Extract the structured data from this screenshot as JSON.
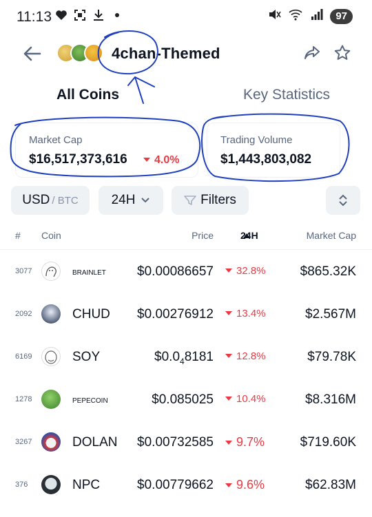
{
  "status_bar": {
    "time": "11:13",
    "battery": "97"
  },
  "header": {
    "title": "4chan-Themed"
  },
  "tabs": [
    {
      "label": "All Coins"
    },
    {
      "label": "Key Statistics"
    }
  ],
  "stats": {
    "market_cap_label": "Market Cap",
    "market_cap_value": "$16,517,373,616",
    "market_cap_change": "4.0%",
    "trading_volume_label": "Trading Volume",
    "trading_volume_value": "$1,443,803,082"
  },
  "controls": {
    "currency": "USD",
    "currency_alt": "/ BTC",
    "period": "24H",
    "filters": "Filters"
  },
  "table": {
    "headers": {
      "rank": "#",
      "coin": "Coin",
      "price": "Price",
      "change": "24H",
      "market_cap": "Market Cap"
    },
    "rows": [
      {
        "rank": "3077",
        "name": "BRAINLET",
        "price": "$0.00086657",
        "change": "32.8%",
        "market_cap": "$865.32K"
      },
      {
        "rank": "2092",
        "name": "CHUD",
        "price": "$0.00276912",
        "change": "13.4%",
        "market_cap": "$2.567M"
      },
      {
        "rank": "6169",
        "name": "SOY",
        "price_prefix": "$0.0",
        "price_sub": "4",
        "price_suffix": "8181",
        "change": "12.8%",
        "market_cap": "$79.78K"
      },
      {
        "rank": "1278",
        "name": "PEPECOIN",
        "price": "$0.085025",
        "change": "10.4%",
        "market_cap": "$8.316M"
      },
      {
        "rank": "3267",
        "name": "DOLAN",
        "price": "$0.00732585",
        "change": "9.7%",
        "market_cap": "$719.60K"
      },
      {
        "rank": "376",
        "name": "NPC",
        "price": "$0.00779662",
        "change": "9.6%",
        "market_cap": "$62.83M"
      }
    ]
  },
  "colors": {
    "negative": "#ea3943",
    "text": "#0d1421",
    "muted": "#58667e",
    "annotation_ink": "#1f3fbf"
  }
}
